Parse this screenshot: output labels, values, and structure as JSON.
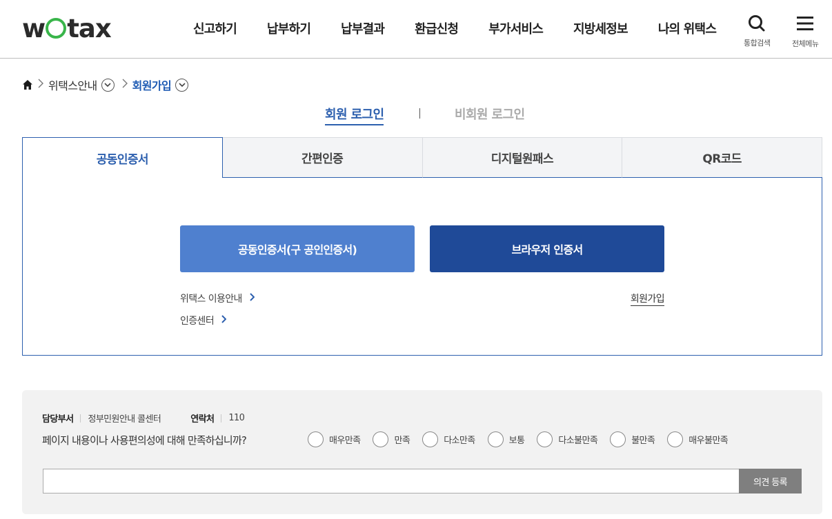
{
  "brand": {
    "logo_text": "wetax",
    "accent_color": "#39b54a"
  },
  "nav": {
    "items": [
      "신고하기",
      "납부하기",
      "납부결과",
      "환급신청",
      "부가서비스",
      "지방세정보",
      "나의 위택스"
    ],
    "search_label": "통합검색",
    "menu_label": "전체메뉴"
  },
  "breadcrumb": {
    "home_icon": "home-icon",
    "level1": "위택스안내",
    "level2": "회원가입"
  },
  "login_switch": {
    "member": "회원 로그인",
    "guest": "비회원 로그인"
  },
  "tabs": [
    "공동인증서",
    "간편인증",
    "디지털원패스",
    "QR코드"
  ],
  "active_tab": "공동인증서",
  "panel": {
    "cert_button": "공동인증서(구 공인인증서)",
    "browser_button": "브라우저 인증서",
    "guide_link": "위택스 이용안내",
    "center_link": "인증센터",
    "join_link": "회원가입"
  },
  "survey": {
    "dept_label": "담당부서",
    "dept_value": "정부민원안내 콜센터",
    "contact_label": "연락처",
    "contact_value": "110",
    "question": "페이지 내용이나 사용편의성에 대해 만족하십니까?",
    "options": [
      "매우만족",
      "만족",
      "다소만족",
      "보통",
      "다소불만족",
      "불만족",
      "매우불만족"
    ],
    "submit": "의견 등록"
  },
  "colors": {
    "primary": "#2c5fae",
    "cert_button": "#4f80cf",
    "browser_button": "#1f4a98"
  }
}
